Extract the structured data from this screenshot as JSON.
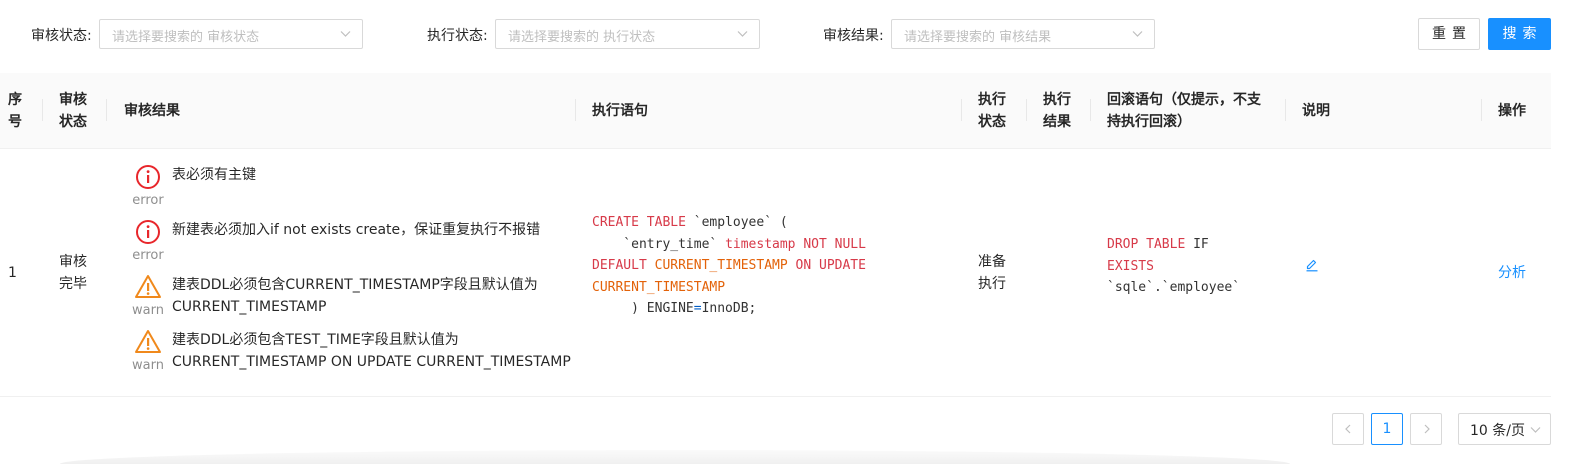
{
  "filters": [
    {
      "label": "审核状态:",
      "placeholder": "请选择要搜索的 审核状态"
    },
    {
      "label": "执行状态:",
      "placeholder": "请选择要搜索的 执行状态"
    },
    {
      "label": "审核结果:",
      "placeholder": "请选择要搜索的 审核结果"
    }
  ],
  "buttons": {
    "reset": "重置",
    "search": "搜索"
  },
  "table": {
    "headers": {
      "index": [
        "序",
        "号"
      ],
      "audit_status": [
        "审核",
        "状态"
      ],
      "audit_result": "审核结果",
      "sql": "执行语句",
      "exec_status": [
        "执行",
        "状态"
      ],
      "exec_result": [
        "执行",
        "结果"
      ],
      "rollback": [
        "回滚语句（仅提示，不支",
        "持执行回滚）"
      ],
      "description": "说明",
      "action": "操作"
    },
    "rows": [
      {
        "index": "1",
        "audit_status": [
          "审核",
          "完毕"
        ],
        "audit_results": [
          {
            "level": "error",
            "icon": "error-circle-icon",
            "lines": [
              "表必须有主键"
            ]
          },
          {
            "level": "error",
            "icon": "error-circle-icon",
            "lines": [
              "新建表必须加入if not exists create，保证重复执行不报错"
            ]
          },
          {
            "level": "warn",
            "icon": "warning-triangle-icon",
            "lines": [
              "建表DDL必须包含CURRENT_TIMESTAMP字段且默认值为",
              "CURRENT_TIMESTAMP"
            ]
          },
          {
            "level": "warn",
            "icon": "warning-triangle-icon",
            "lines": [
              "建表DDL必须包含TEST_TIME字段且默认值为",
              "CURRENT_TIMESTAMP ON UPDATE CURRENT_TIMESTAMP"
            ]
          }
        ],
        "sql": {
          "l1_kw": "CREATE TABLE",
          "l1_rest": " `employee` (",
          "l2_id": "    `entry_time` ",
          "l2_type": "timestamp",
          "l2_kw": " NOT NULL",
          "l3_kw": "DEFAULT",
          "l3_fn": " CURRENT_TIMESTAMP",
          "l3_kw2": " ON UPDATE",
          "l4_fn": "CURRENT_TIMESTAMP",
          "l5_a": "     ) ENGINE",
          "l5_op": "=",
          "l5_b": "InnoDB;"
        },
        "exec_status": [
          "准备",
          "执行"
        ],
        "rollback": {
          "l1_kw": "DROP TABLE",
          "l1_rest": " IF",
          "l2_kw": "EXISTS",
          "l3": "`sqle`.`employee`"
        },
        "description_icon": "edit-icon",
        "action": "分析"
      }
    ]
  },
  "pagination": {
    "prev": "‹",
    "current": "1",
    "next": "›",
    "page_size": "10 条/页"
  },
  "colors": {
    "primary": "#1890ff",
    "error": "#e8262b",
    "warn": "#f0891c",
    "sql_keyword": "#d73a49",
    "sql_function": "#e36209"
  }
}
